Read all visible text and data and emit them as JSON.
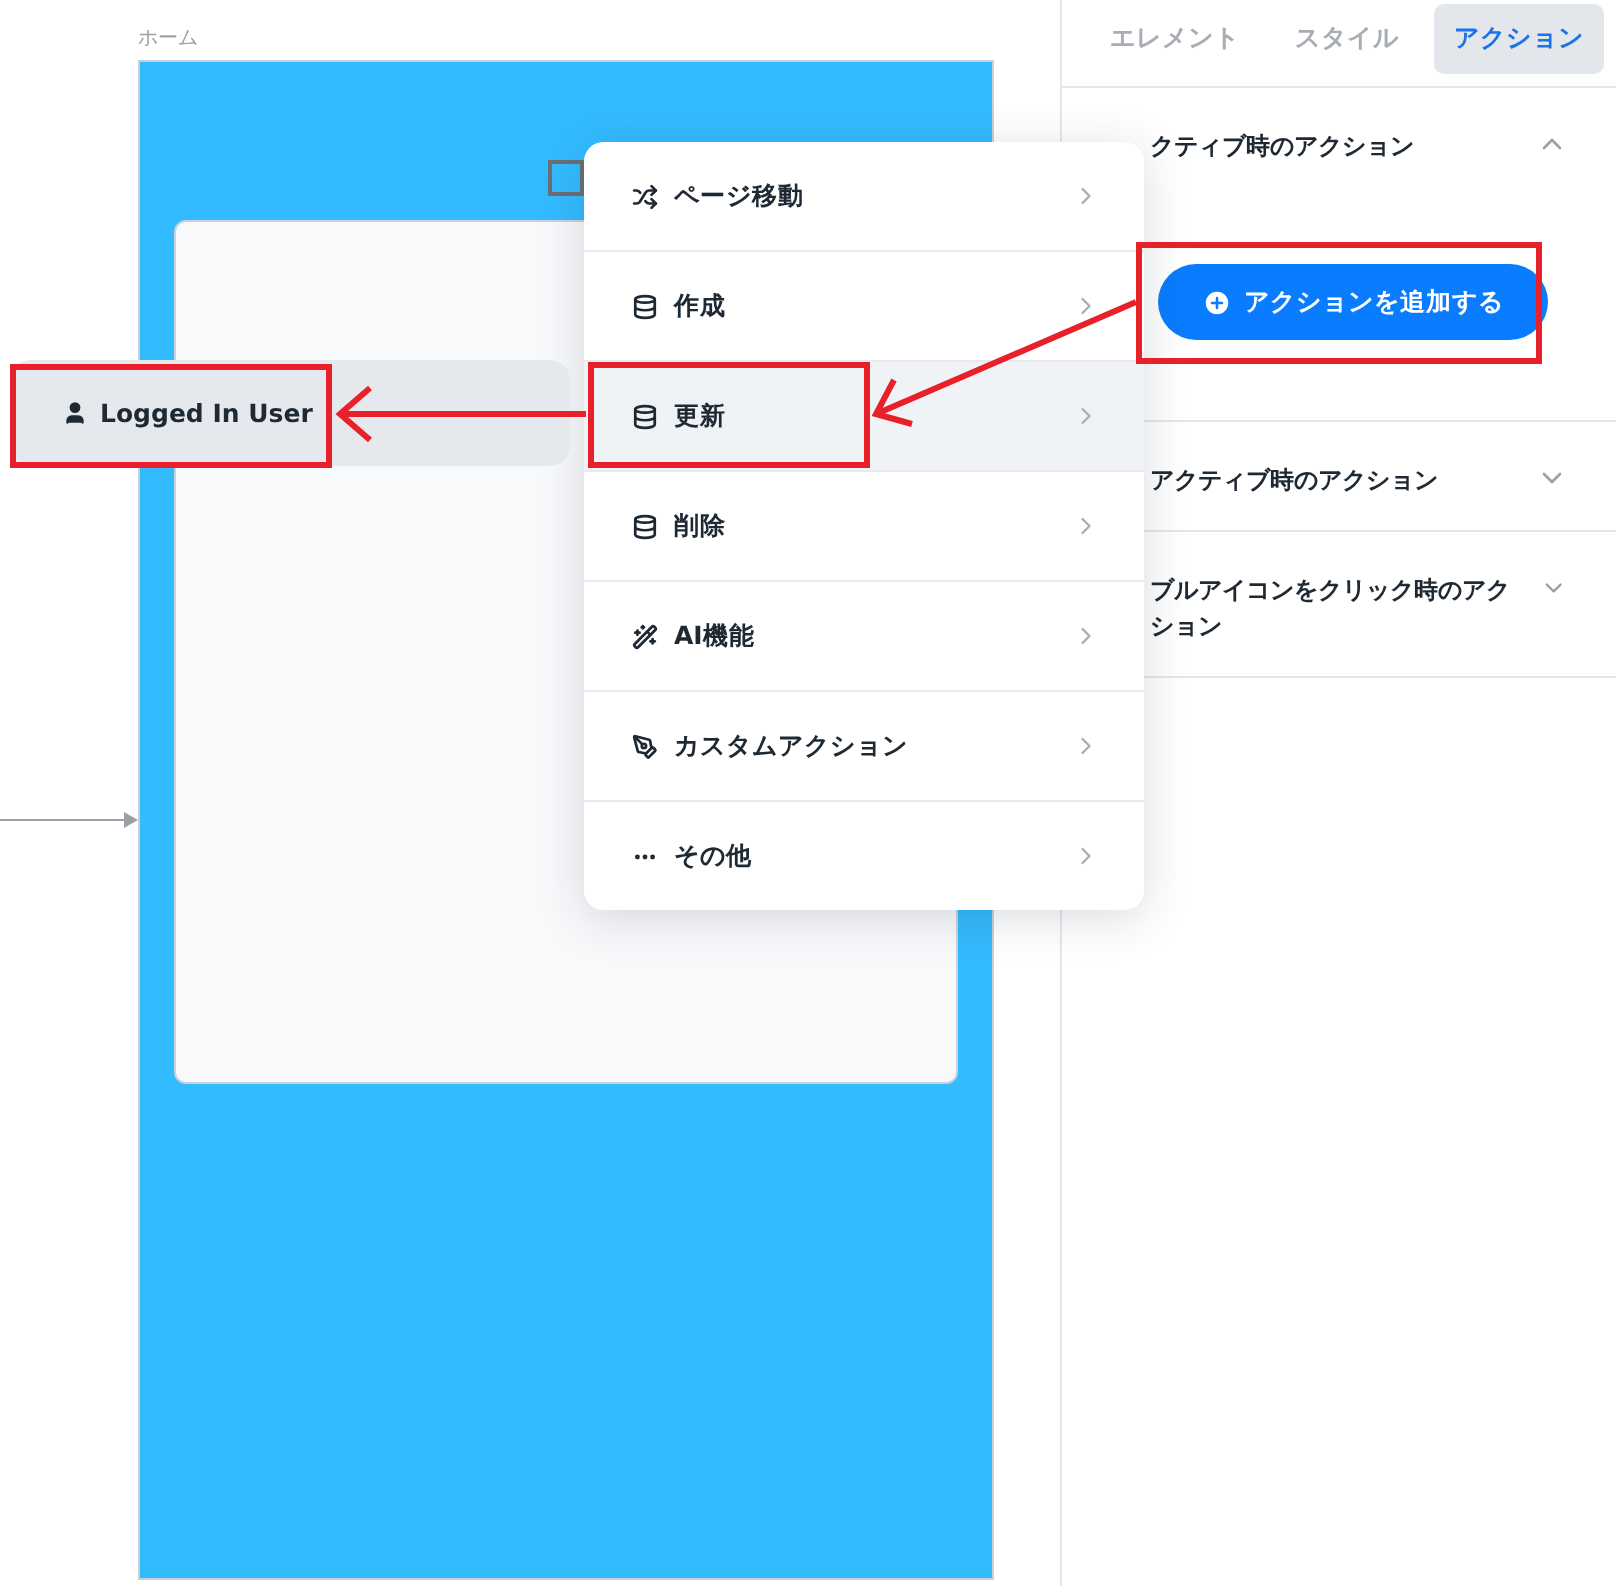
{
  "canvas": {
    "page_label": "ホーム"
  },
  "user_chip": {
    "label": "Logged In User"
  },
  "action_menu": {
    "items": [
      {
        "label": "ページ移動",
        "selected": false
      },
      {
        "label": "作成",
        "selected": false
      },
      {
        "label": "更新",
        "selected": true
      },
      {
        "label": "削除",
        "selected": false
      },
      {
        "label": "AI機能",
        "selected": false
      },
      {
        "label": "カスタムアクション",
        "selected": false
      },
      {
        "label": "その他",
        "selected": false
      }
    ]
  },
  "panel": {
    "tabs": [
      {
        "label": "エレメント",
        "selected": false
      },
      {
        "label": "スタイル",
        "selected": false
      },
      {
        "label": "アクション",
        "selected": true
      }
    ],
    "sections": [
      {
        "title": "クティブ時のアクション",
        "expanded": true,
        "button": "アクションを追加する"
      },
      {
        "title": "アクティブ時のアクション",
        "expanded": false
      },
      {
        "title": "ブルアイコンをクリック時のアクション",
        "expanded": false
      }
    ]
  }
}
